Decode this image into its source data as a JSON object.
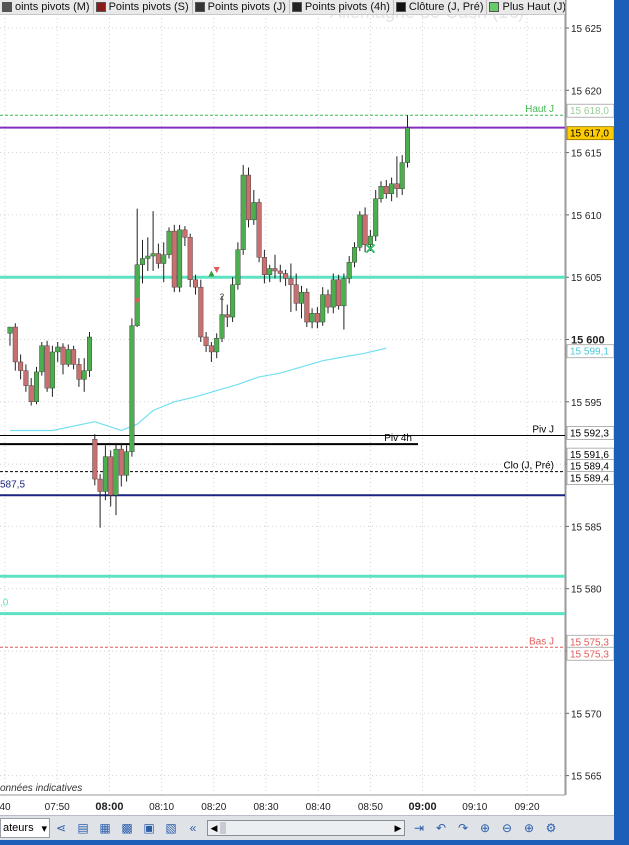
{
  "legend": [
    {
      "label": "oints pivots (M)",
      "color": "#555555"
    },
    {
      "label": "Points pivots (S)",
      "color": "#8b1a1a"
    },
    {
      "label": "Points pivots (J)",
      "color": "#333333"
    },
    {
      "label": "Points pivots (4h)",
      "color": "#222222"
    },
    {
      "label": "Clôture (J, Pré)",
      "color": "#111111"
    },
    {
      "label": "Plus Haut (J)",
      "color": "#66cc66"
    }
  ],
  "watermark": "Allemagne 30 Cash (1€)",
  "note": "onnées indicatives",
  "colors": {
    "up": "#4cae4c",
    "down": "#c87070",
    "line_teal": "#5de3c2",
    "line_purple": "#8a2bc0",
    "line_navy": "#1a237e",
    "vwap": "#73e0f0",
    "haut": "#3fb950",
    "bas": "#e05a5a"
  },
  "chart_data": {
    "type": "candlestick",
    "ylim": [
      15562,
      15627
    ],
    "x_ticks": [
      "40",
      "07:50",
      "08:00",
      "08:10",
      "08:20",
      "08:30",
      "08:40",
      "08:50",
      "09:00",
      "09:10",
      "09:20"
    ],
    "x_tick_bold": [
      "08:00",
      "09:00"
    ],
    "y_ticks": [
      "15 625",
      "15 620",
      "15 615",
      "15 610",
      "15 605",
      "15 600",
      "15 595",
      "15 590",
      "15 585",
      "15 580",
      "15 575",
      "15 570",
      "15 565"
    ],
    "y_tick_bold": [
      "15 600"
    ],
    "levels": [
      {
        "name": "Haut J",
        "price": 15618.0,
        "style": "dashed",
        "color": "#3fb950",
        "label": "Haut J",
        "tag": "15 618,0"
      },
      {
        "name": "current",
        "price": 15617.0,
        "style": "solid",
        "color": "#8a2bc0",
        "label": "",
        "tag": "15 617,0"
      },
      {
        "name": "teal-a",
        "price": 15605.0,
        "style": "solid",
        "color": "#5de3c2",
        "label": "",
        "tag": ""
      },
      {
        "name": "vwap",
        "price": 15599.1,
        "style": "none",
        "color": "#4dd0e1",
        "label": "",
        "tag": "15 599,1"
      },
      {
        "name": "Piv J",
        "price": 15592.3,
        "style": "solid-thin",
        "color": "#000000",
        "label": "Piv J",
        "tag": "15 592,3"
      },
      {
        "name": "Piv 4h",
        "price": 15591.6,
        "style": "solid",
        "color": "#000000",
        "label": "Piv 4h",
        "tag": "15 591,6"
      },
      {
        "name": "Clo (J, Pré)",
        "price": 15589.4,
        "style": "dashed",
        "color": "#000000",
        "label": "Clo (J, Pré)",
        "tag": "15 589,4"
      },
      {
        "name": "close-2",
        "price": 15589.4,
        "style": "none",
        "color": "#000000",
        "label": "",
        "tag": "15 589,4"
      },
      {
        "name": "navy",
        "price": 15587.5,
        "style": "solid",
        "color": "#1a237e",
        "label": "587,5",
        "tag": ""
      },
      {
        "name": "teal-b",
        "price": 15581.0,
        "style": "solid",
        "color": "#5de3c2",
        "label": "",
        "tag": ""
      },
      {
        "name": "teal-c",
        "price": 15578.0,
        "style": "solid",
        "color": "#5de3c2",
        "label": ",0",
        "tag": ""
      },
      {
        "name": "Bas J",
        "price": 15575.3,
        "style": "dashed",
        "color": "#e05a5a",
        "label": "Bas J",
        "tag": "15 575,3"
      },
      {
        "name": "bas-2",
        "price": 15575.3,
        "style": "none",
        "color": "#e05a5a",
        "label": "",
        "tag": "15 575,3"
      }
    ],
    "candles": [
      {
        "o": 15600.5,
        "h": 15601.0,
        "l": 15599.5,
        "c": 15601.0
      },
      {
        "o": 15601.0,
        "h": 15601.3,
        "l": 15597.5,
        "c": 15598.2
      },
      {
        "o": 15598.2,
        "h": 15598.8,
        "l": 15596.8,
        "c": 15597.5
      },
      {
        "o": 15597.5,
        "h": 15598.0,
        "l": 15595.8,
        "c": 15596.3
      },
      {
        "o": 15596.3,
        "h": 15596.9,
        "l": 15594.7,
        "c": 15595.0
      },
      {
        "o": 15595.0,
        "h": 15597.8,
        "l": 15594.8,
        "c": 15597.4
      },
      {
        "o": 15597.4,
        "h": 15599.8,
        "l": 15597.1,
        "c": 15599.5
      },
      {
        "o": 15599.5,
        "h": 15599.9,
        "l": 15595.8,
        "c": 15596.1
      },
      {
        "o": 15596.1,
        "h": 15599.5,
        "l": 15595.4,
        "c": 15599.0
      },
      {
        "o": 15599.0,
        "h": 15599.8,
        "l": 15598.2,
        "c": 15599.4
      },
      {
        "o": 15599.4,
        "h": 15599.7,
        "l": 15597.2,
        "c": 15598.0
      },
      {
        "o": 15598.0,
        "h": 15599.6,
        "l": 15597.8,
        "c": 15599.2
      },
      {
        "o": 15599.2,
        "h": 15599.5,
        "l": 15597.6,
        "c": 15598.0
      },
      {
        "o": 15598.0,
        "h": 15598.5,
        "l": 15596.2,
        "c": 15596.8
      },
      {
        "o": 15596.8,
        "h": 15598.5,
        "l": 15595.8,
        "c": 15597.5
      },
      {
        "o": 15597.5,
        "h": 15600.6,
        "l": 15597.0,
        "c": 15600.2
      },
      {
        "o": 15592.0,
        "h": 15592.4,
        "l": 15588.3,
        "c": 15588.8
      },
      {
        "o": 15588.8,
        "h": 15589.2,
        "l": 15584.9,
        "c": 15587.8
      },
      {
        "o": 15587.8,
        "h": 15591.5,
        "l": 15587.1,
        "c": 15590.6
      },
      {
        "o": 15590.6,
        "h": 15591.1,
        "l": 15586.6,
        "c": 15587.5
      },
      {
        "o": 15587.5,
        "h": 15591.7,
        "l": 15585.9,
        "c": 15591.2
      },
      {
        "o": 15591.2,
        "h": 15591.7,
        "l": 15588.2,
        "c": 15589.1
      },
      {
        "o": 15589.1,
        "h": 15591.5,
        "l": 15588.6,
        "c": 15591.0
      },
      {
        "o": 15591.0,
        "h": 15601.7,
        "l": 15590.6,
        "c": 15601.1
      },
      {
        "o": 15601.1,
        "h": 15610.5,
        "l": 15601.0,
        "c": 15606.0
      },
      {
        "o": 15606.0,
        "h": 15608.0,
        "l": 15604.5,
        "c": 15606.5
      },
      {
        "o": 15606.5,
        "h": 15608.2,
        "l": 15605.5,
        "c": 15606.7
      },
      {
        "o": 15606.7,
        "h": 15610.3,
        "l": 15605.5,
        "c": 15606.9
      },
      {
        "o": 15606.9,
        "h": 15607.7,
        "l": 15605.7,
        "c": 15606.1
      },
      {
        "o": 15606.1,
        "h": 15607.8,
        "l": 15604.6,
        "c": 15606.8
      },
      {
        "o": 15606.8,
        "h": 15609.0,
        "l": 15606.5,
        "c": 15608.7
      },
      {
        "o": 15608.7,
        "h": 15609.2,
        "l": 15603.8,
        "c": 15604.2
      },
      {
        "o": 15604.2,
        "h": 15609.2,
        "l": 15603.8,
        "c": 15608.8
      },
      {
        "o": 15608.8,
        "h": 15609.1,
        "l": 15607.5,
        "c": 15608.2
      },
      {
        "o": 15608.2,
        "h": 15608.5,
        "l": 15604.2,
        "c": 15604.8
      },
      {
        "o": 15604.8,
        "h": 15605.2,
        "l": 15603.6,
        "c": 15604.2
      },
      {
        "o": 15604.2,
        "h": 15604.8,
        "l": 15599.8,
        "c": 15600.2
      },
      {
        "o": 15600.2,
        "h": 15600.6,
        "l": 15599.0,
        "c": 15599.5
      },
      {
        "o": 15599.5,
        "h": 15599.8,
        "l": 15598.2,
        "c": 15599.0
      },
      {
        "o": 15599.0,
        "h": 15600.5,
        "l": 15598.5,
        "c": 15600.1
      },
      {
        "o": 15600.1,
        "h": 15603.5,
        "l": 15599.8,
        "c": 15602.0
      },
      {
        "o": 15602.0,
        "h": 15602.8,
        "l": 15601.0,
        "c": 15601.8
      },
      {
        "o": 15601.8,
        "h": 15605.0,
        "l": 15601.4,
        "c": 15604.4
      },
      {
        "o": 15604.4,
        "h": 15607.8,
        "l": 15604.0,
        "c": 15607.2
      },
      {
        "o": 15607.2,
        "h": 15614.0,
        "l": 15606.8,
        "c": 15613.2
      },
      {
        "o": 15613.2,
        "h": 15613.8,
        "l": 15609.0,
        "c": 15609.6
      },
      {
        "o": 15609.6,
        "h": 15612.0,
        "l": 15609.2,
        "c": 15611.0
      },
      {
        "o": 15611.0,
        "h": 15611.3,
        "l": 15606.2,
        "c": 15606.6
      },
      {
        "o": 15606.6,
        "h": 15607.2,
        "l": 15604.5,
        "c": 15605.2
      },
      {
        "o": 15605.2,
        "h": 15606.0,
        "l": 15604.6,
        "c": 15605.7
      },
      {
        "o": 15605.7,
        "h": 15606.8,
        "l": 15604.9,
        "c": 15605.5
      },
      {
        "o": 15605.5,
        "h": 15606.0,
        "l": 15604.6,
        "c": 15605.3
      },
      {
        "o": 15605.3,
        "h": 15605.6,
        "l": 15604.3,
        "c": 15604.9
      },
      {
        "o": 15604.9,
        "h": 15606.1,
        "l": 15602.2,
        "c": 15604.4
      },
      {
        "o": 15604.4,
        "h": 15605.3,
        "l": 15602.3,
        "c": 15602.9
      },
      {
        "o": 15602.9,
        "h": 15604.3,
        "l": 15601.7,
        "c": 15603.8
      },
      {
        "o": 15603.8,
        "h": 15604.1,
        "l": 15601.0,
        "c": 15601.4
      },
      {
        "o": 15601.4,
        "h": 15602.5,
        "l": 15600.9,
        "c": 15602.1
      },
      {
        "o": 15602.1,
        "h": 15602.6,
        "l": 15600.9,
        "c": 15601.4
      },
      {
        "o": 15601.4,
        "h": 15604.2,
        "l": 15601.1,
        "c": 15603.6
      },
      {
        "o": 15603.6,
        "h": 15604.0,
        "l": 15602.1,
        "c": 15602.6
      },
      {
        "o": 15602.6,
        "h": 15605.3,
        "l": 15602.1,
        "c": 15604.8
      },
      {
        "o": 15604.8,
        "h": 15605.2,
        "l": 15602.4,
        "c": 15602.7
      },
      {
        "o": 15602.7,
        "h": 15605.3,
        "l": 15600.8,
        "c": 15604.9
      },
      {
        "o": 15604.9,
        "h": 15606.7,
        "l": 15604.5,
        "c": 15606.2
      },
      {
        "o": 15606.2,
        "h": 15607.8,
        "l": 15605.8,
        "c": 15607.4
      },
      {
        "o": 15607.4,
        "h": 15610.3,
        "l": 15607.1,
        "c": 15610.0
      },
      {
        "o": 15610.0,
        "h": 15610.6,
        "l": 15607.0,
        "c": 15607.6
      },
      {
        "o": 15607.6,
        "h": 15608.8,
        "l": 15607.1,
        "c": 15608.3
      },
      {
        "o": 15608.3,
        "h": 15612.0,
        "l": 15607.9,
        "c": 15611.3
      },
      {
        "o": 15611.3,
        "h": 15612.7,
        "l": 15611.0,
        "c": 15612.3
      },
      {
        "o": 15612.3,
        "h": 15612.8,
        "l": 15611.3,
        "c": 15611.7
      },
      {
        "o": 15611.7,
        "h": 15613.0,
        "l": 15611.1,
        "c": 15612.5
      },
      {
        "o": 15612.5,
        "h": 15614.7,
        "l": 15611.4,
        "c": 15612.1
      },
      {
        "o": 15612.1,
        "h": 15614.8,
        "l": 15611.6,
        "c": 15614.2
      },
      {
        "o": 15614.2,
        "h": 15618.0,
        "l": 15613.8,
        "c": 15617.0
      }
    ],
    "vwap": [
      [
        0,
        15592.7
      ],
      [
        8,
        15592.7
      ],
      [
        16,
        15593.4
      ],
      [
        21,
        15592.7
      ],
      [
        24,
        15593.2
      ],
      [
        27,
        15594.3
      ],
      [
        31,
        15595.0
      ],
      [
        35,
        15595.4
      ],
      [
        39,
        15595.9
      ],
      [
        43,
        15596.4
      ],
      [
        47,
        15597.0
      ],
      [
        51,
        15597.3
      ],
      [
        55,
        15597.8
      ],
      [
        59,
        15598.3
      ],
      [
        63,
        15598.6
      ],
      [
        67,
        15598.9
      ],
      [
        71,
        15599.3
      ]
    ],
    "arrows": [
      {
        "i": 24,
        "dir": "down",
        "price": 15603.0,
        "color": "#e05a5a"
      },
      {
        "i": 38,
        "dir": "up",
        "price": 15605.3,
        "color": "#3c9a3c"
      },
      {
        "i": 39,
        "dir": "down",
        "price": 15605.5,
        "color": "#e05a5a"
      },
      {
        "i": 68,
        "dir": "x",
        "price": 15607.3,
        "color": "#2bbd66"
      }
    ],
    "annotations": [
      {
        "i": 40,
        "price": 15604.0,
        "text": "2"
      }
    ]
  },
  "toolbar": {
    "indicator_label": "ateurs",
    "scroll_left": "◀",
    "scroll_right": "▶"
  }
}
